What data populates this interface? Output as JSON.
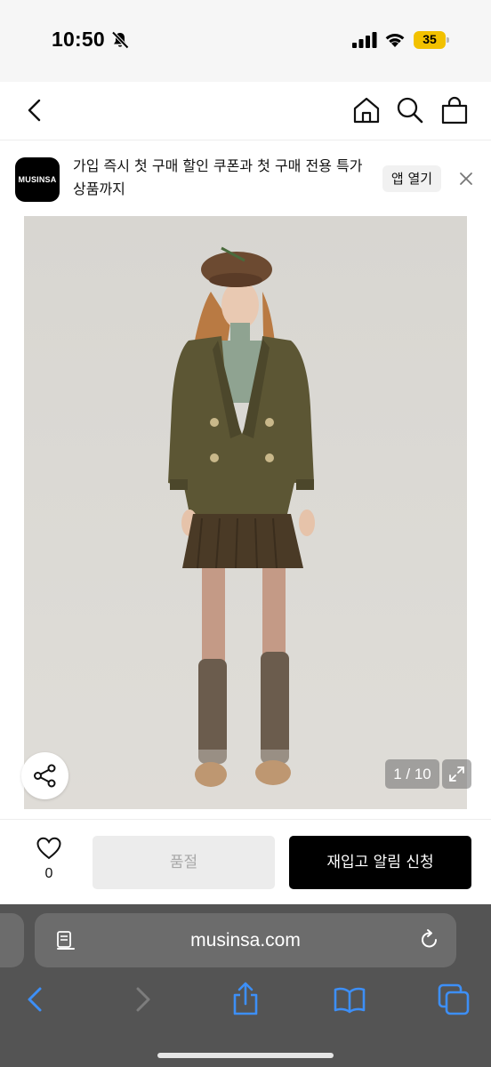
{
  "status_bar": {
    "time": "10:50",
    "battery": "35"
  },
  "nav": {
    "back_icon": "chevron-left-icon",
    "home_icon": "home-icon",
    "search_icon": "search-icon",
    "cart_icon": "shopping-bag-icon"
  },
  "app_banner": {
    "logo_text": "MUSINSA",
    "message": "가입 즉시 첫 구매 할인 쿠폰과 첫 구매 전용 특가 상품까지",
    "open_label": "앱 열기",
    "close_icon": "close-icon"
  },
  "gallery": {
    "counter": "1 / 10",
    "share_icon": "share-icon",
    "expand_icon": "expand-icon"
  },
  "purchase": {
    "like_icon": "heart-icon",
    "like_count": "0",
    "soldout_label": "품절",
    "restock_label": "재입고 알림 신청"
  },
  "browser": {
    "url": "musinsa.com",
    "reader_icon": "reader-icon",
    "reload_icon": "reload-icon",
    "toolbar_icons": [
      "back-arrow-icon",
      "forward-arrow-icon",
      "share-upload-icon",
      "bookmarks-icon",
      "tabs-icon"
    ]
  },
  "colors": {
    "accent_blue": "#3d8ff7",
    "button_black": "#000000",
    "battery_yellow": "#f2c100",
    "browser_bg": "#545454"
  }
}
